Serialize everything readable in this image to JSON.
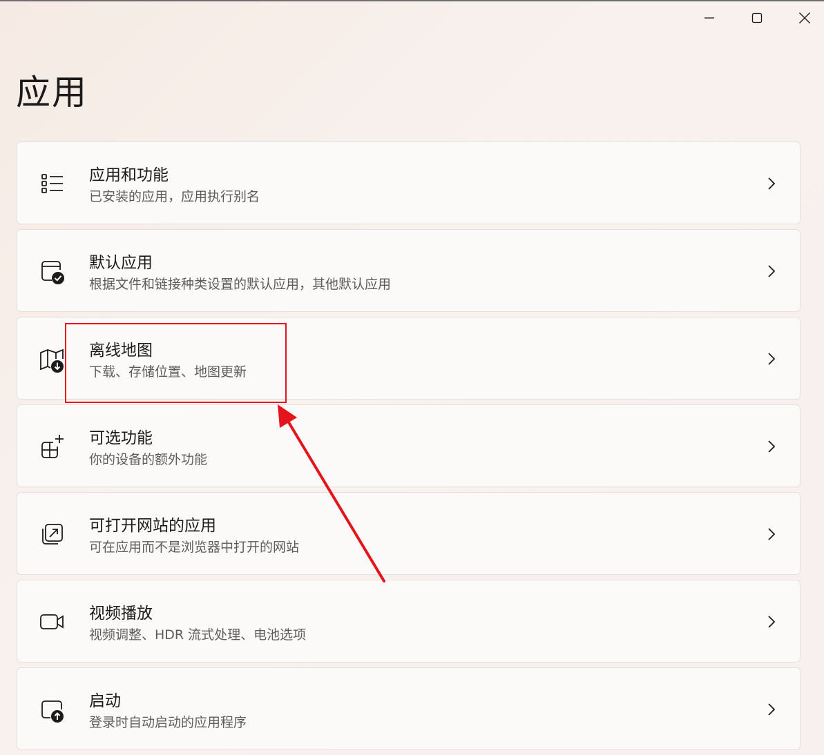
{
  "window": {
    "minimize_icon": "minimize-icon",
    "maximize_icon": "maximize-icon",
    "close_icon": "close-icon"
  },
  "page": {
    "title": "应用"
  },
  "items": [
    {
      "title": "应用和功能",
      "subtitle": "已安装的应用，应用执行别名",
      "icon": "list-icon"
    },
    {
      "title": "默认应用",
      "subtitle": "根据文件和链接种类设置的默认应用，其他默认应用",
      "icon": "default-apps-icon"
    },
    {
      "title": "离线地图",
      "subtitle": "下载、存储位置、地图更新",
      "icon": "offline-map-icon"
    },
    {
      "title": "可选功能",
      "subtitle": "你的设备的额外功能",
      "icon": "optional-features-icon"
    },
    {
      "title": "可打开网站的应用",
      "subtitle": "可在应用而不是浏览器中打开的网站",
      "icon": "open-website-icon"
    },
    {
      "title": "视频播放",
      "subtitle": "视频调整、HDR 流式处理、电池选项",
      "icon": "video-camera-icon"
    },
    {
      "title": "启动",
      "subtitle": "登录时自动启动的应用程序",
      "icon": "startup-icon"
    }
  ],
  "annotation": {
    "color": "#e5141c",
    "target_item": 2
  }
}
